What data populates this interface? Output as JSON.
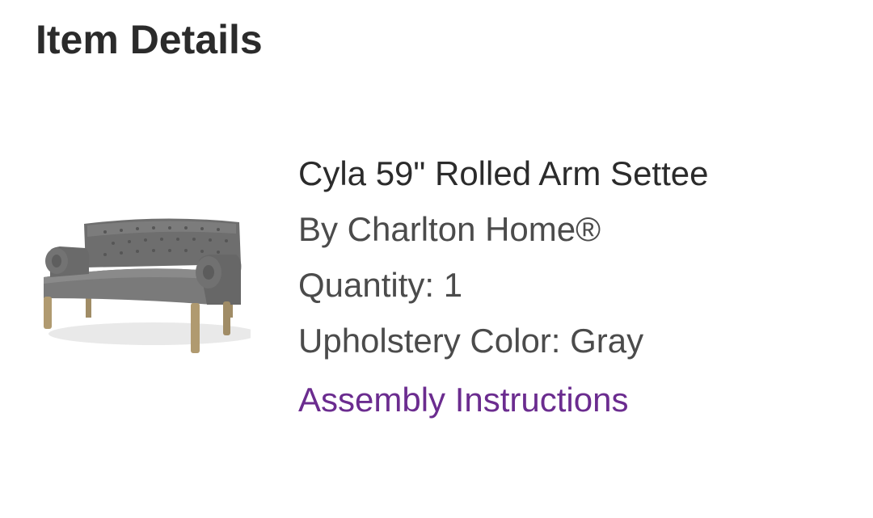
{
  "section": {
    "title": "Item Details"
  },
  "item": {
    "image_icon": "settee-product-image",
    "name": "Cyla 59\" Rolled Arm Settee",
    "brand": "By Charlton Home®",
    "quantity": "Quantity: 1",
    "option": "Upholstery Color: Gray",
    "assembly_link": "Assembly Instructions"
  },
  "colors": {
    "link": "#6b2c8f",
    "title": "#2b2b2b",
    "text": "#4b4b4b",
    "upholstery": "#7a7a7a"
  }
}
